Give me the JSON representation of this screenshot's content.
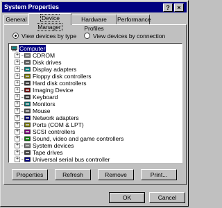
{
  "window": {
    "title": "System Properties",
    "help_glyph": "?",
    "close_glyph": "×"
  },
  "tabs": [
    {
      "label": "General",
      "active": false
    },
    {
      "label": "Device Manager",
      "active": true
    },
    {
      "label": "Hardware Profiles",
      "active": false
    },
    {
      "label": "Performance",
      "active": false
    }
  ],
  "view_options": {
    "by_type": {
      "label": "View devices by type",
      "selected": true
    },
    "by_connection": {
      "label": "View devices by connection",
      "selected": false
    }
  },
  "tree": {
    "root": {
      "label": "Computer",
      "icon": "computer-icon"
    },
    "items": [
      {
        "label": "CDROM",
        "icon": "cdrom-icon"
      },
      {
        "label": "Disk drives",
        "icon": "disk-drive-icon"
      },
      {
        "label": "Display adapters",
        "icon": "display-icon"
      },
      {
        "label": "Floppy disk controllers",
        "icon": "floppy-controller-icon"
      },
      {
        "label": "Hard disk controllers",
        "icon": "hard-disk-controller-icon"
      },
      {
        "label": "Imaging Device",
        "icon": "camera-icon"
      },
      {
        "label": "Keyboard",
        "icon": "keyboard-icon"
      },
      {
        "label": "Monitors",
        "icon": "monitor-icon"
      },
      {
        "label": "Mouse",
        "icon": "mouse-icon"
      },
      {
        "label": "Network adapters",
        "icon": "network-icon"
      },
      {
        "label": "Ports (COM & LPT)",
        "icon": "port-icon"
      },
      {
        "label": "SCSI controllers",
        "icon": "scsi-icon"
      },
      {
        "label": "Sound, video and game controllers",
        "icon": "sound-icon"
      },
      {
        "label": "System devices",
        "icon": "system-icon"
      },
      {
        "label": "Tape drives",
        "icon": "tape-icon"
      },
      {
        "label": "Universal serial bus controller",
        "icon": "usb-icon"
      }
    ]
  },
  "buttons": {
    "properties": "Properties",
    "refresh": "Refresh",
    "remove": "Remove",
    "print": "Print...",
    "ok": "OK",
    "cancel": "Cancel"
  },
  "colors": {
    "face": "#c0c0c0",
    "title_bar": "#000080",
    "selection": "#000080"
  }
}
